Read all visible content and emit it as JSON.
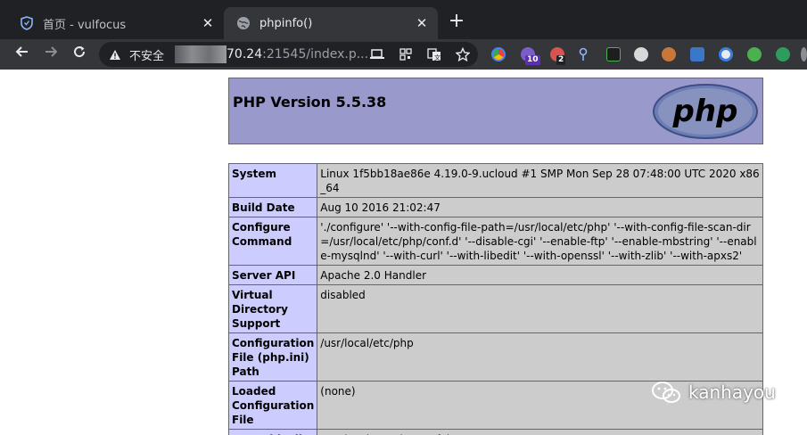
{
  "tabs": [
    {
      "title": "首页 - vulfocus",
      "icon": "shield-icon",
      "active": false
    },
    {
      "title": "phpinfo()",
      "icon": "globe-icon",
      "active": true
    }
  ],
  "address_bar": {
    "security_label": "不安全",
    "host_visible": "70.24",
    "url_rest": ":21545/index.p..."
  },
  "extensions": {
    "badge_10": "10",
    "badge_2": "2"
  },
  "colors": {
    "header_bg": "#9999cc",
    "label_bg": "#ccccff",
    "value_bg": "#cccccc"
  },
  "php": {
    "version_title": "PHP Version 5.5.38",
    "logo_text": "php"
  },
  "rows": [
    {
      "label": "System",
      "value": "Linux 1f5bb18ae86e 4.19.0-9.ucloud #1 SMP Mon Sep 28 07:48:00 UTC 2020 x86_64"
    },
    {
      "label": "Build Date",
      "value": "Aug 10 2016 21:02:47"
    },
    {
      "label": "Configure Command",
      "value": "'./configure' '--with-config-file-path=/usr/local/etc/php' '--with-config-file-scan-dir=/usr/local/etc/php/conf.d' '--disable-cgi' '--enable-ftp' '--enable-mbstring' '--enable-mysqlnd' '--with-curl' '--with-libedit' '--with-openssl' '--with-zlib' '--with-apxs2'"
    },
    {
      "label": "Server API",
      "value": "Apache 2.0 Handler"
    },
    {
      "label": "Virtual Directory Support",
      "value": "disabled"
    },
    {
      "label": "Configuration File (php.ini) Path",
      "value": "/usr/local/etc/php"
    },
    {
      "label": "Loaded Configuration File",
      "value": "(none)"
    },
    {
      "label": "Scan this dir",
      "value": "/usr/local/etc/php/conf.d"
    }
  ],
  "watermark": "kanhayou"
}
